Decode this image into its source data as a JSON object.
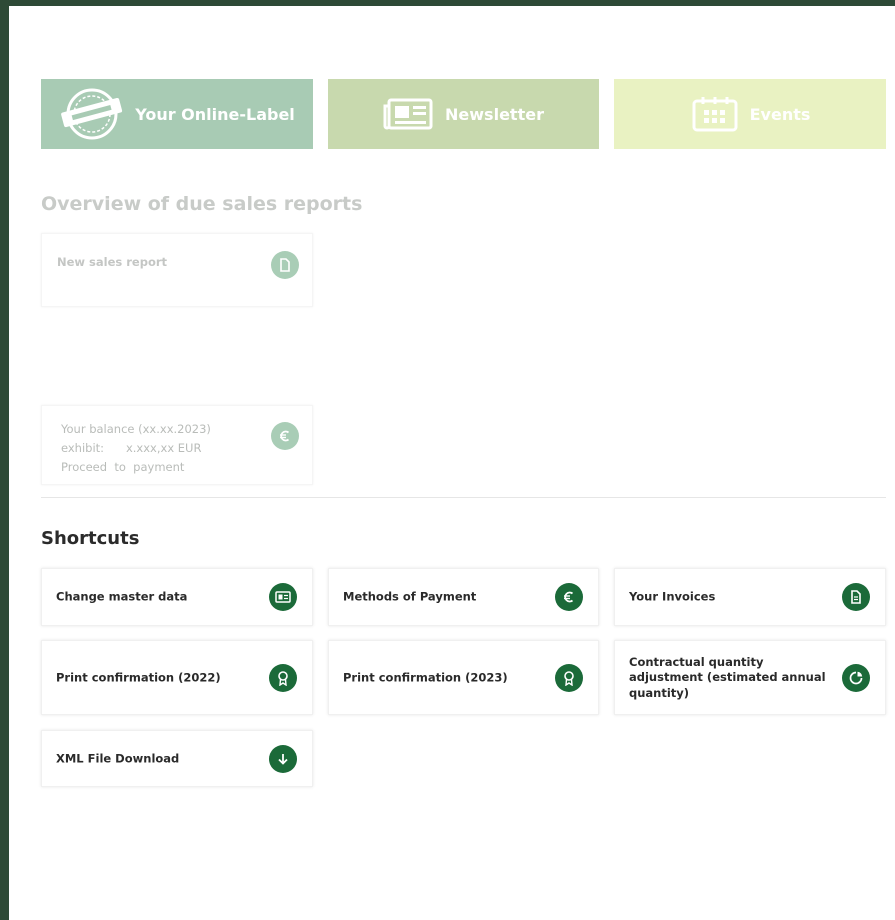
{
  "banners": {
    "online_label": "Your Online-Label",
    "newsletter": "Newsletter",
    "events": "Events"
  },
  "overview": {
    "title": "Overview of due sales reports",
    "new_sales_report": "New sales report",
    "balance_line1": "Your balance (xx.xx.2023)",
    "balance_line2": "exhibit:      x.xxx,xx EUR",
    "balance_line3": "Proceed  to  payment"
  },
  "shortcuts": {
    "title": "Shortcuts",
    "items": [
      {
        "label": "Change master data",
        "icon": "id-card-icon"
      },
      {
        "label": "Methods of Payment",
        "icon": "euro-icon"
      },
      {
        "label": "Your Invoices",
        "icon": "document-icon"
      },
      {
        "label": "Print confirmation (2022)",
        "icon": "award-icon"
      },
      {
        "label": "Print confirmation (2023)",
        "icon": "award-icon"
      },
      {
        "label": "Contractual quantity adjustment (estimated annual quantity)",
        "icon": "pie-chart-icon"
      },
      {
        "label": "XML File Download",
        "icon": "download-icon"
      }
    ]
  },
  "colors": {
    "frame": "#2e4a36",
    "accent_dark": "#1b6a39",
    "banner_label": "#a8cbb4",
    "banner_newsletter": "#c8d9ae",
    "banner_events": "#e9f2c2"
  }
}
